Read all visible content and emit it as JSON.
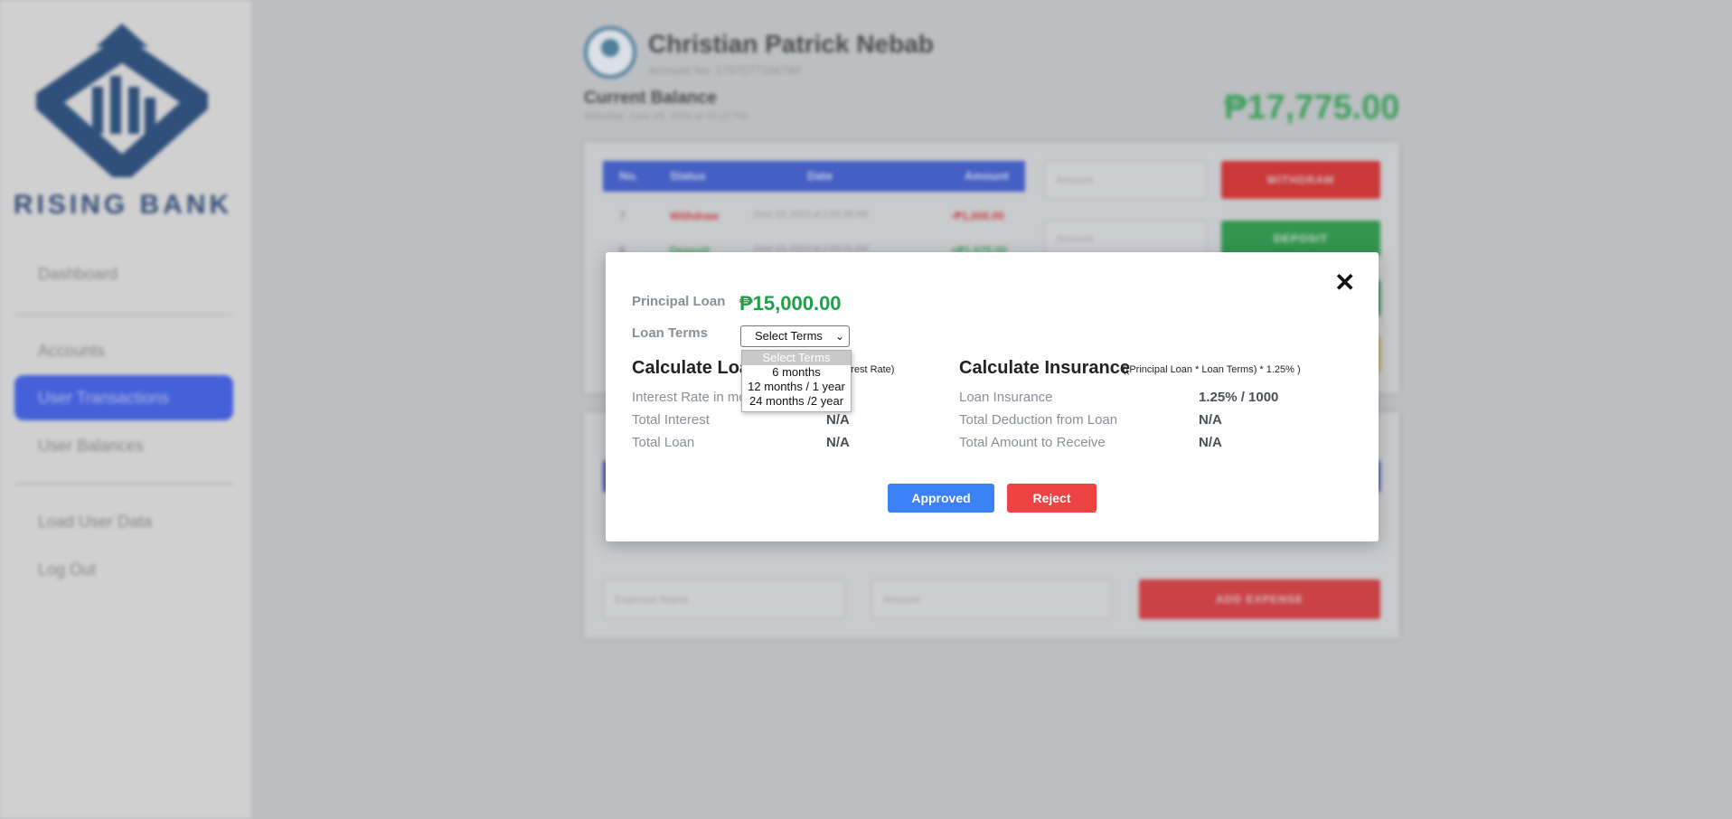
{
  "sidebar": {
    "brand": "RISING BANK",
    "items": [
      {
        "label": "Dashboard",
        "active": false
      },
      {
        "label": "Accounts",
        "active": false
      },
      {
        "label": "User Transactions",
        "active": true
      },
      {
        "label": "User Balances",
        "active": false
      },
      {
        "label": "Load User Data",
        "active": false
      },
      {
        "label": "Log Out",
        "active": false
      }
    ]
  },
  "header": {
    "user_name": "Christian Patrick Nebab",
    "account_no": "Account No: 1767077166799",
    "current_balance_label": "Current Balance",
    "balance_date": "Saturday, June 29, 2024 at 10:22 PM",
    "balance_amount": "₱17,775.00"
  },
  "transactions": {
    "columns": [
      "No.",
      "Status",
      "Date",
      "Amount"
    ],
    "rows": [
      {
        "no": "7",
        "status": "Withdraw",
        "date": "June 13, 2024 at 2:04:38 AM",
        "amount": "-₱1,000.00"
      },
      {
        "no": "6",
        "status": "Deposit",
        "date": "June 13, 2024 at 2:04:31 AM",
        "amount": "+₱1,075.00"
      }
    ]
  },
  "actions": {
    "amount_placeholder": "Amount",
    "withdraw_label": "WITHDRAW",
    "deposit_label": "DEPOSIT",
    "expense_name_placeholder": "Expense Name",
    "add_expense_label": "ADD EXPENSE"
  },
  "modal": {
    "principal_label": "Principal Loan",
    "principal_amount": "₱15,000.00",
    "terms_label": "Loan Terms",
    "terms_selected": "Select Terms",
    "terms_options": [
      "Select Terms",
      "6 months",
      "12 months / 1 year",
      "24 months /2 year"
    ],
    "calc_loan_title": "Calculate Loa",
    "calc_loan_note": "terest Rate)",
    "calc_insurance_title": "Calculate Insurance",
    "calc_insurance_note": "((Principal Loan * Loan Terms) * 1.25% )",
    "loan_rows": [
      {
        "label": "Interest Rate in mo",
        "value": ""
      },
      {
        "label": "Total Interest",
        "value": "N/A"
      },
      {
        "label": "Total Loan",
        "value": "N/A"
      }
    ],
    "insurance_rows": [
      {
        "label": "Loan Insurance",
        "value": "1.25% / 1000"
      },
      {
        "label": "Total Deduction from Loan",
        "value": "N/A"
      },
      {
        "label": "Total Amount to Receive",
        "value": "N/A"
      }
    ],
    "approve_label": "Approved",
    "reject_label": "Reject"
  },
  "colors": {
    "primary": "#3b82f6",
    "danger": "#ef4343",
    "success": "#1ea04b",
    "sidebar_active": "#3d5ee6"
  }
}
